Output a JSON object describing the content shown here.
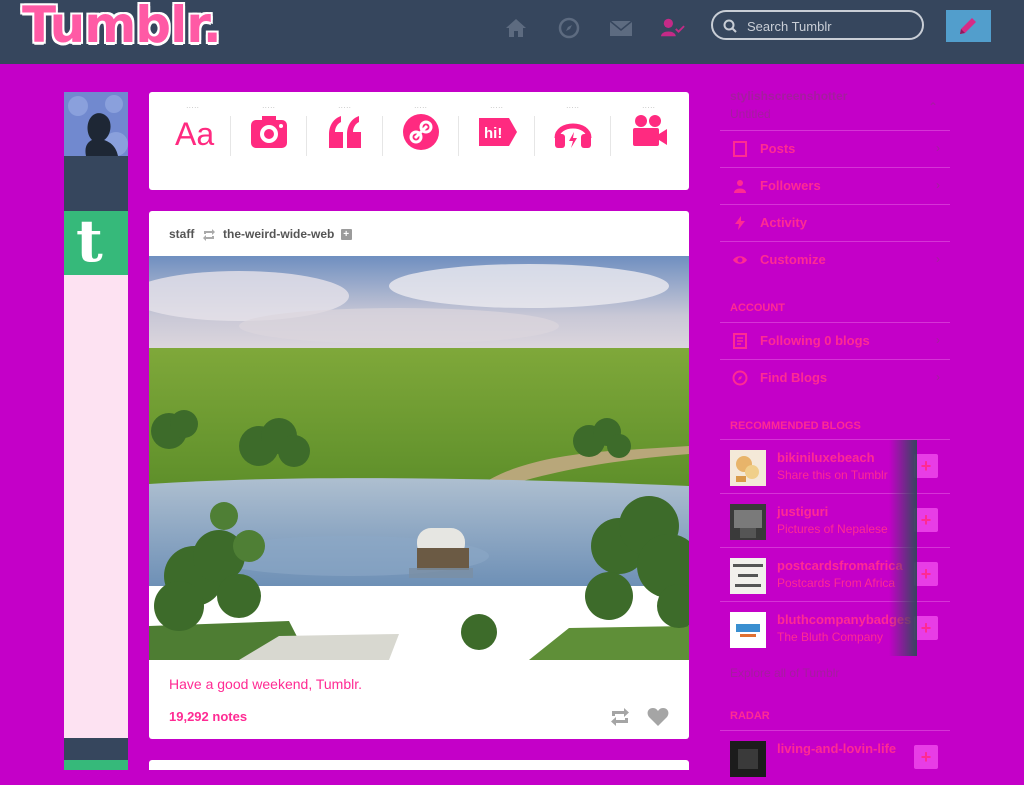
{
  "header": {
    "logo": "Tumblr.",
    "search_placeholder": "Search Tumblr",
    "nav_icons": [
      "home-icon",
      "compass-icon",
      "mail-icon",
      "account-icon"
    ],
    "compose_icon": "pencil-icon"
  },
  "post_types": [
    {
      "label": "Text",
      "icon": "text-icon"
    },
    {
      "label": "Photo",
      "icon": "camera-icon"
    },
    {
      "label": "Quote",
      "icon": "quote-icon"
    },
    {
      "label": "Link",
      "icon": "link-icon"
    },
    {
      "label": "Chat",
      "icon": "chat-icon"
    },
    {
      "label": "Audio",
      "icon": "headphones-icon"
    },
    {
      "label": "Video",
      "icon": "video-camera-icon"
    }
  ],
  "post": {
    "author": "staff",
    "reblogged_from": "the-weird-wide-web",
    "caption": "Have a good weekend, Tumblr.",
    "notes": "19,292 notes",
    "follow_symbol": "+"
  },
  "sidebar": {
    "blog_name": "stylishscreenshotter",
    "blog_subtitle": "Untitled",
    "items": [
      {
        "label": "Posts",
        "icon": "posts-icon"
      },
      {
        "label": "Followers",
        "icon": "followers-icon"
      },
      {
        "label": "Activity",
        "icon": "activity-icon"
      },
      {
        "label": "Customize",
        "icon": "eye-icon"
      }
    ],
    "section_account": "ACCOUNT",
    "account_items": [
      {
        "label": "Following 0 blogs",
        "icon": "following-icon"
      },
      {
        "label": "Find Blogs",
        "icon": "find-icon"
      }
    ],
    "section_recommended": "RECOMMENDED BLOGS",
    "recommended": [
      {
        "name": "bikiniluxebeach",
        "desc": "Share this on Tumblr",
        "follow": "+"
      },
      {
        "name": "justiguri",
        "desc": "Pictures of Nepalese",
        "follow": "+"
      },
      {
        "name": "postcardsfromafrica",
        "desc": "Postcards From Africa",
        "follow": "+"
      },
      {
        "name": "bluthcompanybadges",
        "desc": "The Bluth Company",
        "follow": "+"
      }
    ],
    "explore": "Explore all of Tumblr",
    "section_radar": "RADAR",
    "radar": [
      {
        "name": "living-and-lovin-life",
        "follow": "+"
      }
    ]
  }
}
